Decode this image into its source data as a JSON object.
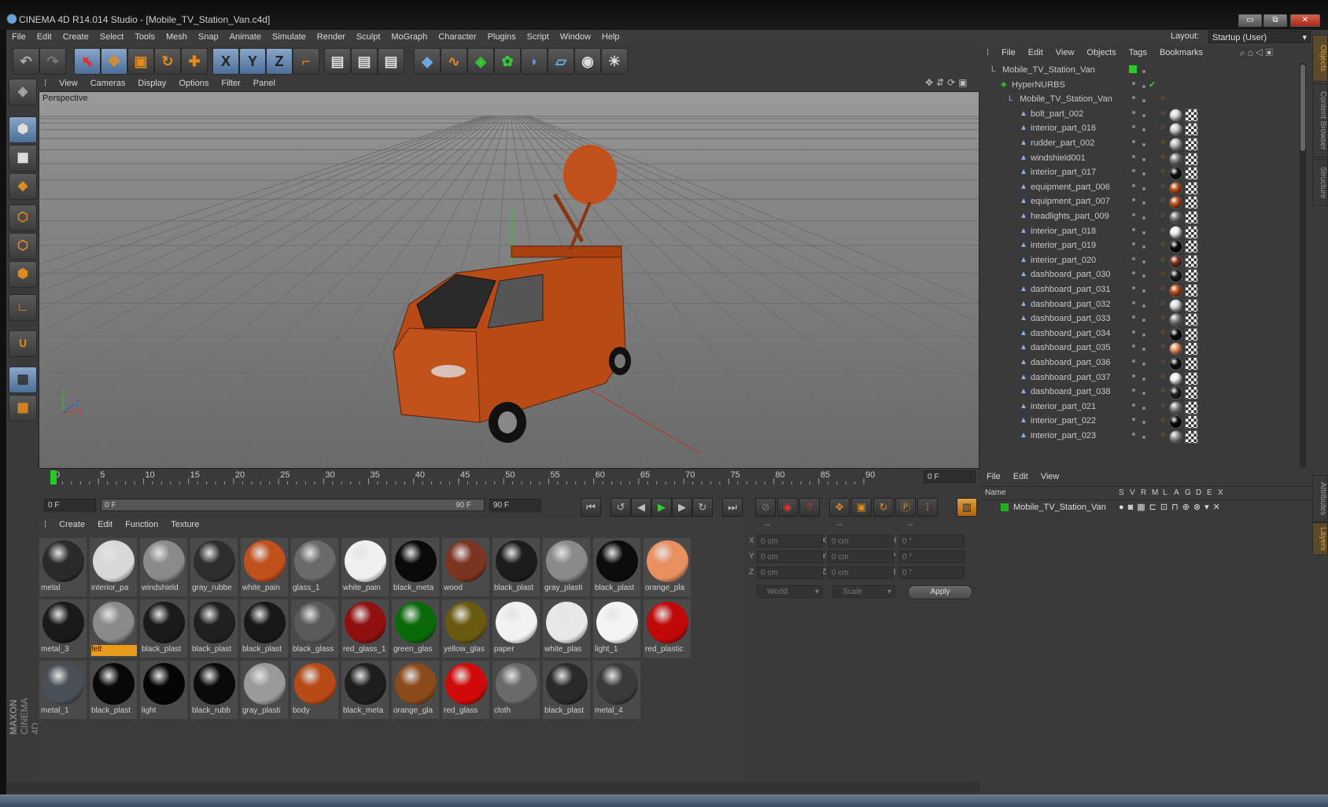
{
  "window": {
    "title": "CINEMA 4D R14.014 Studio - [Mobile_TV_Station_Van.c4d]",
    "min": "▭",
    "max": "⧉",
    "close": "✕"
  },
  "menubar": [
    "File",
    "Edit",
    "Create",
    "Select",
    "Tools",
    "Mesh",
    "Snap",
    "Animate",
    "Simulate",
    "Render",
    "Sculpt",
    "MoGraph",
    "Character",
    "Plugins",
    "Script",
    "Window",
    "Help"
  ],
  "layout": {
    "label": "Layout:",
    "value": "Startup (User)"
  },
  "toolbar_icons": [
    "undo-icon",
    "redo-icon",
    "live-selection-icon",
    "move-icon",
    "scale-icon",
    "rotate-icon",
    "add-object-icon",
    "x-axis-icon",
    "y-axis-icon",
    "z-axis-icon",
    "coordinate-system-icon",
    "render-view-icon",
    "render-picture-viewer-icon",
    "render-settings-icon",
    "cube-icon",
    "spline-icon",
    "nurbs-icon",
    "mograph-cloner-icon",
    "deformer-icon",
    "floor-icon",
    "camera-icon",
    "light-icon"
  ],
  "axis_labels": {
    "x": "X",
    "y": "Y",
    "z": "Z"
  },
  "viewport": {
    "menu": [
      "View",
      "Cameras",
      "Display",
      "Options",
      "Filter",
      "Panel"
    ],
    "label": "Perspective"
  },
  "timeline": {
    "ticks": [
      "0",
      "5",
      "10",
      "15",
      "20",
      "25",
      "30",
      "35",
      "40",
      "45",
      "50",
      "55",
      "60",
      "65",
      "70",
      "75",
      "80",
      "85",
      "90"
    ],
    "current_frame": "0 F",
    "start": "0 F",
    "range_start": "0 F",
    "range_end": "90 F",
    "end": "90 F"
  },
  "materials": {
    "menu": [
      "Create",
      "Edit",
      "Function",
      "Texture"
    ],
    "items": [
      {
        "name": "metal",
        "color": "#2a2a2a"
      },
      {
        "name": "interior_pa",
        "color": "#d8d8d8"
      },
      {
        "name": "windshield",
        "color": "#8a8a8a"
      },
      {
        "name": "gray_rubbe",
        "color": "#2e2e2e"
      },
      {
        "name": "white_pain",
        "color": "#c0501c"
      },
      {
        "name": "glass_1",
        "color": "#6a6a6a"
      },
      {
        "name": "white_pain",
        "color": "#f0f0f0"
      },
      {
        "name": "black_meta",
        "color": "#0a0a0a"
      },
      {
        "name": "wood",
        "color": "#7a3420"
      },
      {
        "name": "black_plast",
        "color": "#1c1c1c"
      },
      {
        "name": "gray_plasti",
        "color": "#8a8a8a"
      },
      {
        "name": "black_plast",
        "color": "#0c0c0c"
      },
      {
        "name": "orange_pla",
        "color": "#e89060"
      },
      {
        "name": "metal_3",
        "color": "#1a1a1a"
      },
      {
        "name": "felt",
        "color": "#8a8a8a"
      },
      {
        "name": "black_plast",
        "color": "#1a1a1a"
      },
      {
        "name": "black_plast",
        "color": "#202020"
      },
      {
        "name": "black_plast",
        "color": "#181818"
      },
      {
        "name": "black_glass",
        "color": "#5a5a5a"
      },
      {
        "name": "red_glass_1",
        "color": "#901010"
      },
      {
        "name": "green_glas",
        "color": "#0a6a0a"
      },
      {
        "name": "yellow_glas",
        "color": "#6a5a10"
      },
      {
        "name": "paper",
        "color": "#f2f2f2"
      },
      {
        "name": "white_plas",
        "color": "#e8e8e8"
      },
      {
        "name": "light_1",
        "color": "#f4f4f4"
      },
      {
        "name": "red_plastic",
        "color": "#c00808"
      },
      {
        "name": "metal_1",
        "color": "#4a5058"
      },
      {
        "name": "black_plast",
        "color": "#080808"
      },
      {
        "name": "light",
        "color": "#050505"
      },
      {
        "name": "black_rubb",
        "color": "#0a0a0a"
      },
      {
        "name": "gray_plasti",
        "color": "#9a9a9a"
      },
      {
        "name": "body",
        "color": "#b84a18"
      },
      {
        "name": "black_meta",
        "color": "#1e1e1e"
      },
      {
        "name": "orange_gla",
        "color": "#8a4a1a"
      },
      {
        "name": "red_glass",
        "color": "#d00a0a"
      },
      {
        "name": "cloth",
        "color": "#6a6a6a"
      },
      {
        "name": "black_plast",
        "color": "#2a2a2a"
      },
      {
        "name": "metal_4",
        "color": "#3a3a3a"
      }
    ],
    "selected_index": 14
  },
  "coordinates": {
    "headers": [
      "--",
      "--",
      "--"
    ],
    "rows": [
      {
        "l1": "X",
        "v1": "0 cm",
        "l2": "X",
        "v2": "0 cm",
        "l3": "H",
        "v3": "0 °"
      },
      {
        "l1": "Y",
        "v1": "0 cm",
        "l2": "Y",
        "v2": "0 cm",
        "l3": "P",
        "v3": "0 °"
      },
      {
        "l1": "Z",
        "v1": "0 cm",
        "l2": "Z",
        "v2": "0 cm",
        "l3": "B",
        "v3": "0 °"
      }
    ],
    "mode": "World",
    "size_mode": "Scale",
    "apply": "Apply"
  },
  "objects": {
    "menu": [
      "File",
      "Edit",
      "View",
      "Objects",
      "Tags",
      "Bookmarks"
    ],
    "rows": [
      {
        "name": "Mobile_TV_Station_Van",
        "type": "null",
        "tag": "none"
      },
      {
        "name": "HyperNURBS",
        "type": "nurbs",
        "tag": "none"
      },
      {
        "name": "Mobile_TV_Station_Van",
        "type": "null",
        "tag": "none"
      },
      {
        "name": "bolt_part_002",
        "type": "poly",
        "tag": "#d8d8d8"
      },
      {
        "name": "interior_part_016",
        "type": "poly",
        "tag": "#cccccc"
      },
      {
        "name": "rudder_part_002",
        "type": "poly",
        "tag": "#bbbbbb"
      },
      {
        "name": "windshield001",
        "type": "poly",
        "tag": "#888888"
      },
      {
        "name": "interior_part_017",
        "type": "poly",
        "tag": "#111111"
      },
      {
        "name": "equipment_part_006",
        "type": "poly",
        "tag": "#c0501c"
      },
      {
        "name": "equipment_part_007",
        "type": "poly",
        "tag": "#c0501c"
      },
      {
        "name": "headlights_part_009",
        "type": "poly",
        "tag": "#777777"
      },
      {
        "name": "interior_part_018",
        "type": "poly",
        "tag": "#eeeeee"
      },
      {
        "name": "interior_part_019",
        "type": "poly",
        "tag": "#0a0a0a"
      },
      {
        "name": "interior_part_020",
        "type": "poly",
        "tag": "#7a3420"
      },
      {
        "name": "dashboard_part_030",
        "type": "poly",
        "tag": "#1a1a1a"
      },
      {
        "name": "dashboard_part_031",
        "type": "poly",
        "tag": "#c0501c"
      },
      {
        "name": "dashboard_part_032",
        "type": "poly",
        "tag": "#dddddd"
      },
      {
        "name": "dashboard_part_033",
        "type": "poly",
        "tag": "#8a8a8a"
      },
      {
        "name": "dashboard_part_034",
        "type": "poly",
        "tag": "#0a0a0a"
      },
      {
        "name": "dashboard_part_035",
        "type": "poly",
        "tag": "#e89060"
      },
      {
        "name": "dashboard_part_036",
        "type": "poly",
        "tag": "#111111"
      },
      {
        "name": "dashboard_part_037",
        "type": "poly",
        "tag": "#eeeeee"
      },
      {
        "name": "dashboard_part_038",
        "type": "poly",
        "tag": "#222222"
      },
      {
        "name": "interior_part_021",
        "type": "poly",
        "tag": "#888888"
      },
      {
        "name": "interior_part_022",
        "type": "poly",
        "tag": "#0a0a0a"
      },
      {
        "name": "interior_part_023",
        "type": "poly",
        "tag": "#999999"
      }
    ]
  },
  "layers": {
    "menu": [
      "File",
      "Edit",
      "View"
    ],
    "columns": [
      "Name",
      "S",
      "V",
      "R",
      "M",
      "L",
      "A",
      "G",
      "D",
      "E",
      "X"
    ],
    "rows": [
      {
        "name": "Mobile_TV_Station_Van",
        "color": "#20b020"
      }
    ]
  },
  "side_tabs": [
    "Objects",
    "Content Browser",
    "Structure",
    "Attributes",
    "Layers"
  ],
  "branding": {
    "maxon": "MAXON",
    "c4d": "CINEMA 4D"
  }
}
